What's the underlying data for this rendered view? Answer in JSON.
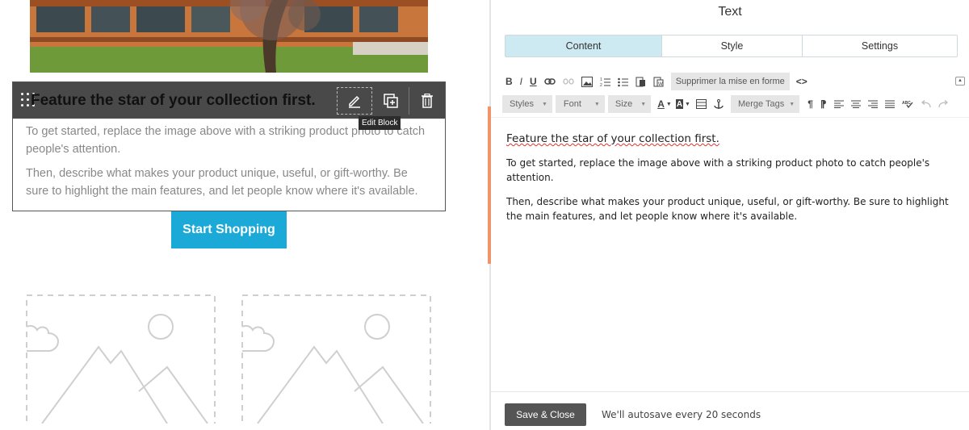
{
  "canvas": {
    "block": {
      "heading": "Feature the star of your collection first.",
      "paragraph1": "To get started, replace the image above with a striking product photo to catch people's attention.",
      "paragraph2": "Then, describe what makes your product unique, useful, or gift-worthy. Be sure to highlight the main features, and let people know where it's available.",
      "tooltip": "Edit Block"
    },
    "cta_label": "Start Shopping"
  },
  "panel": {
    "title": "Text",
    "tabs": [
      "Content",
      "Style",
      "Settings"
    ],
    "active_tab": "Content",
    "toolbar": {
      "bold": "B",
      "italic": "I",
      "underline": "U",
      "clear_format": "Supprimer la mise en forme",
      "source": "<>",
      "styles": "Styles",
      "font": "Font",
      "size": "Size",
      "text_color": "A",
      "bg_color": "A",
      "merge_tags": "Merge Tags",
      "pilcrow": "¶",
      "pilcrow_rtl": "⁋"
    },
    "editor": {
      "heading": "Feature the star of your collection first.",
      "paragraph1": "To get started, replace the image above with a striking product photo to catch people's attention.",
      "paragraph2": "Then, describe what makes your product unique, useful, or gift-worthy. Be sure to highlight the main features, and let people know where it's available."
    },
    "footer": {
      "save_label": "Save & Close",
      "autosave_text": "We'll autosave every 20 seconds"
    }
  },
  "colors": {
    "cta": "#1ba9d8",
    "active_tab": "#cdeaf3",
    "block_toolbar": "#494949",
    "edit_indicator": "#f0956a"
  }
}
